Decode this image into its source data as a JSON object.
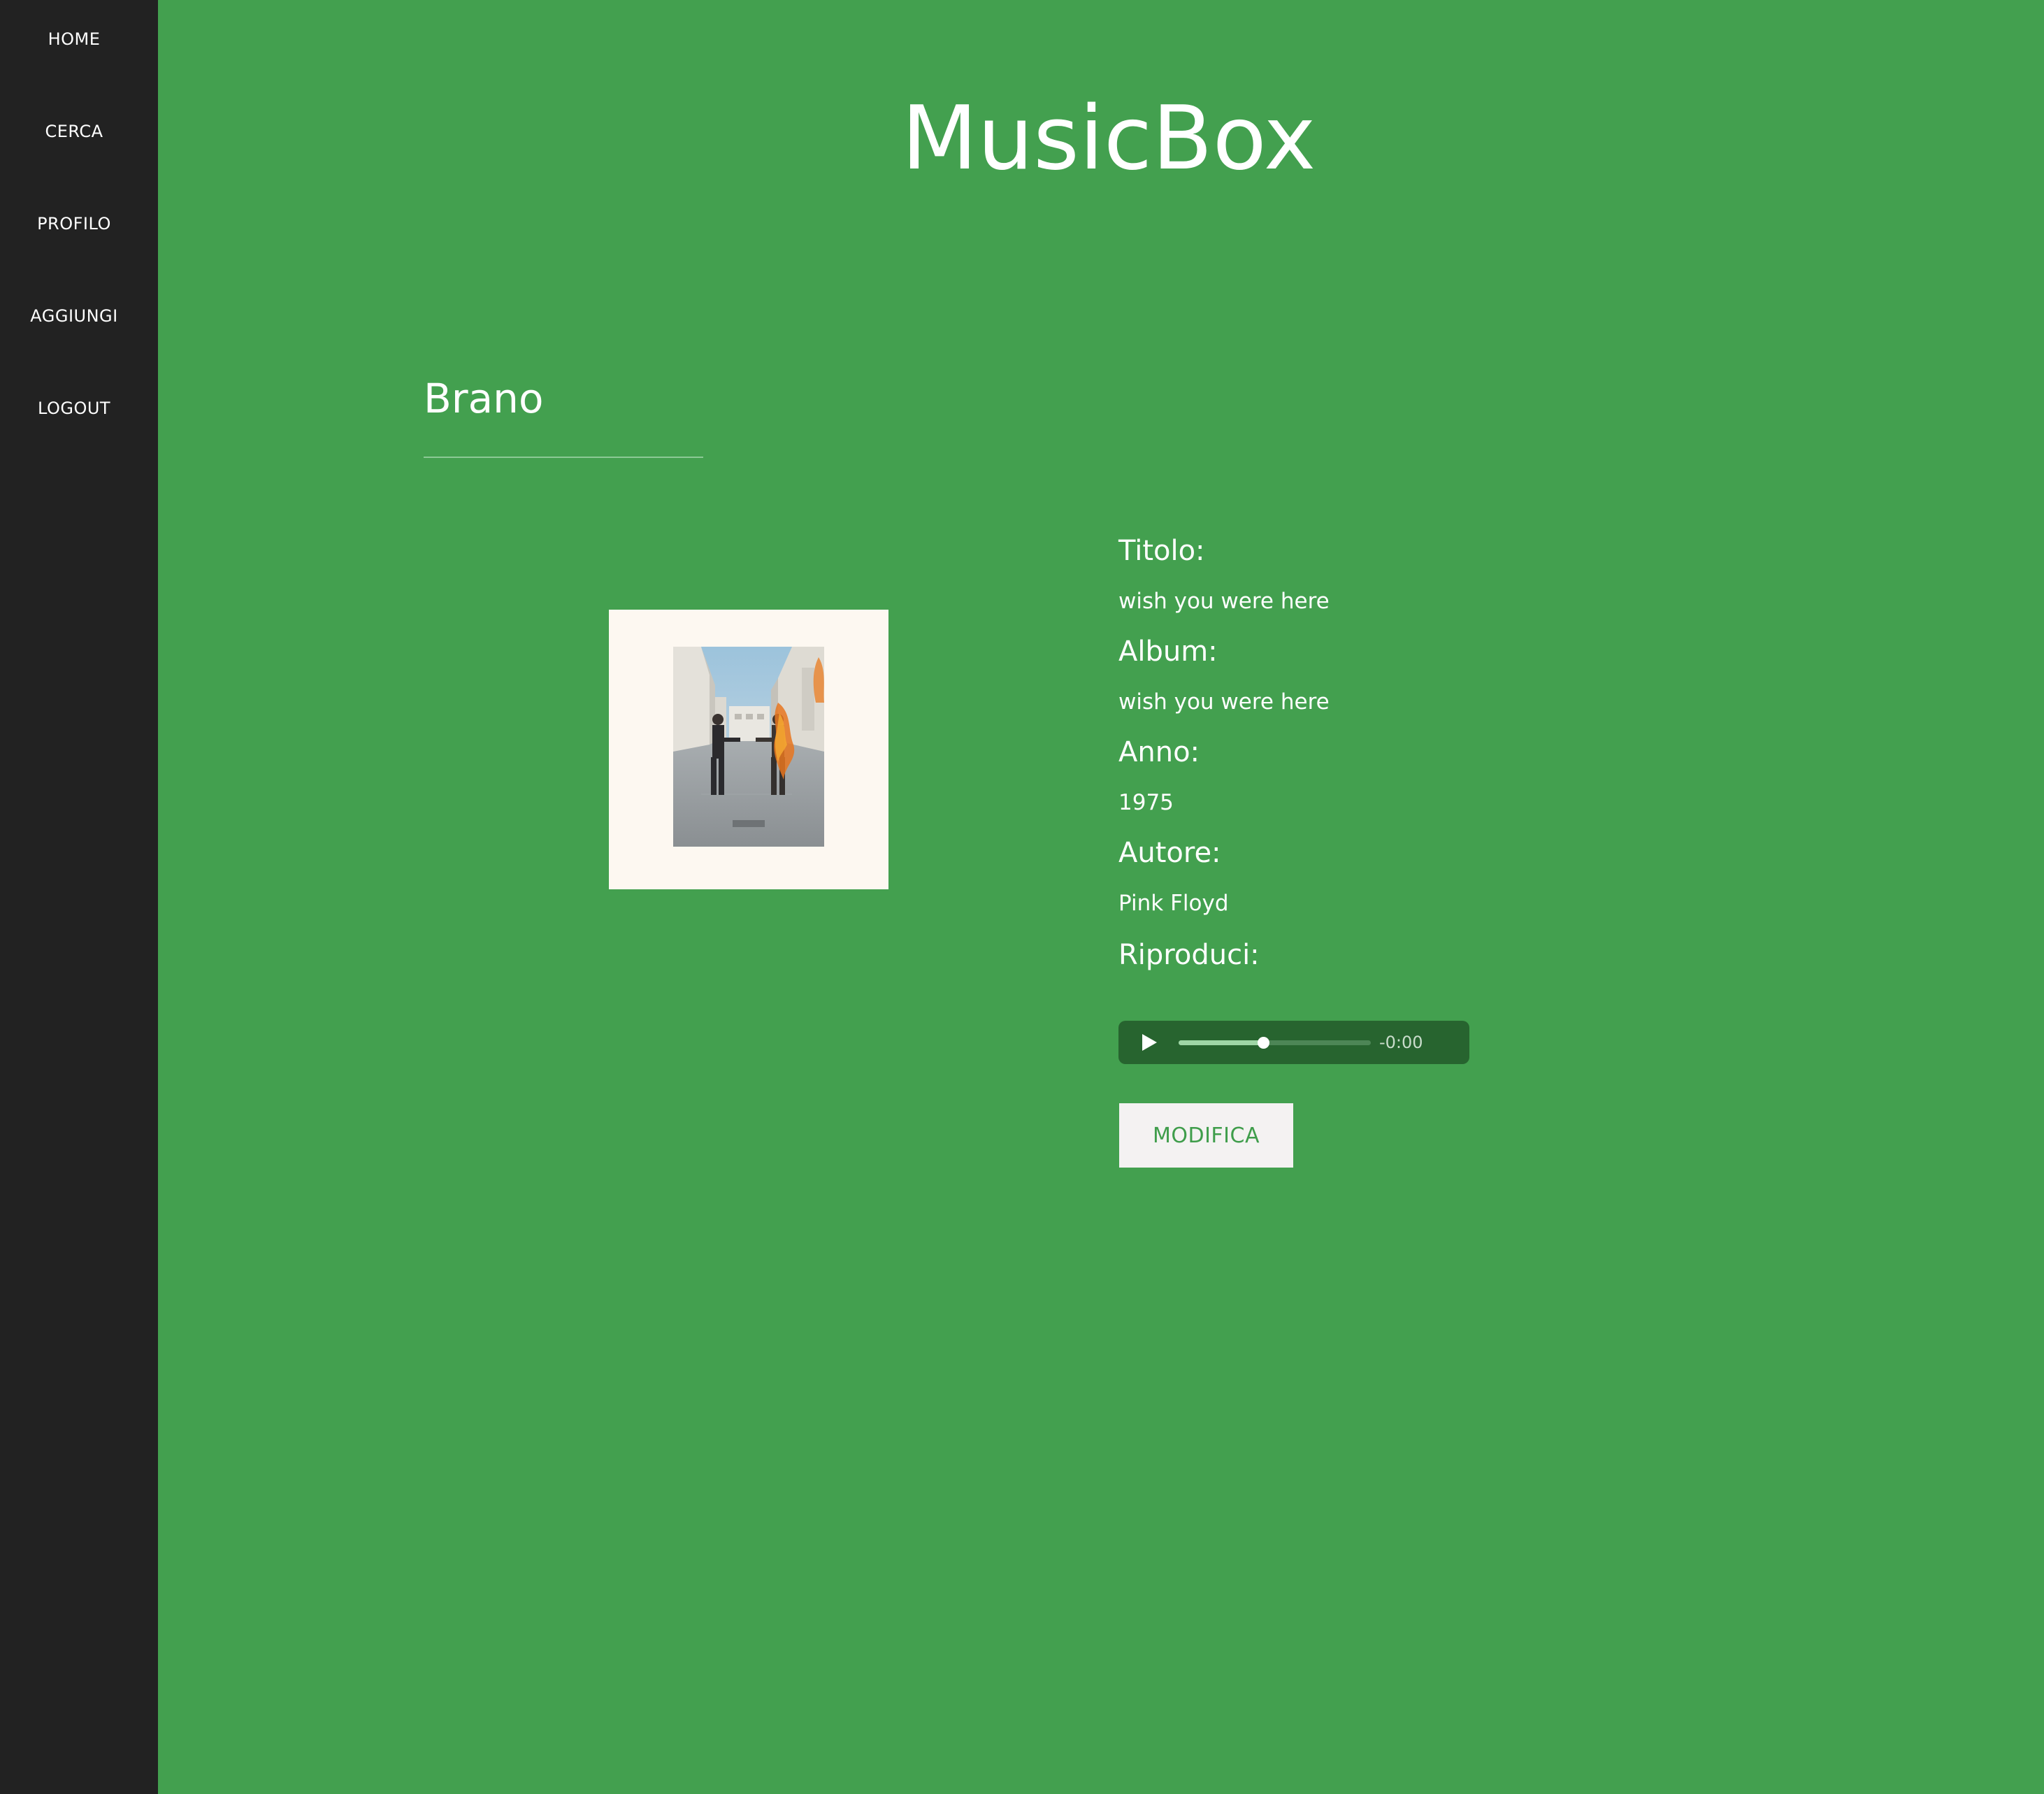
{
  "sidebar": {
    "items": [
      {
        "label": "HOME"
      },
      {
        "label": "CERCA"
      },
      {
        "label": "PROFILO"
      },
      {
        "label": "AGGIUNGI"
      },
      {
        "label": "LOGOUT"
      }
    ]
  },
  "header": {
    "app_title": "MusicBox"
  },
  "section": {
    "title": "Brano"
  },
  "song": {
    "fields": [
      {
        "label": "Titolo:",
        "value": "wish you were here"
      },
      {
        "label": "Album:",
        "value": "wish you were here"
      },
      {
        "label": "Anno:",
        "value": "1975"
      },
      {
        "label": "Autore:",
        "value": "Pink Floyd"
      }
    ],
    "play_label": "Riproduci:"
  },
  "player": {
    "time_remaining": "-0:00",
    "progress_fraction": 0.44,
    "play_icon": "play-icon"
  },
  "actions": {
    "edit_label": "MODIFICA"
  },
  "colors": {
    "background": "#43a04f",
    "sidebar": "#222222",
    "player_bg": "#27642f",
    "button_text": "#3f9d4b"
  }
}
